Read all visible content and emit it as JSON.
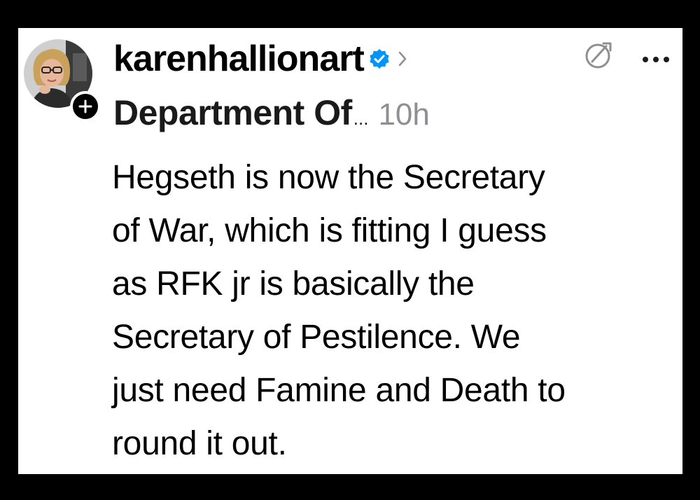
{
  "post": {
    "author": {
      "username": "karenhallionart",
      "verified": true,
      "avatar_icon": "profile-photo"
    },
    "topic": "Department Of",
    "topic_ellipsis": "...",
    "timestamp": "10h",
    "text_lines": [
      "Hegseth is now the Secretary",
      "of War, which is fitting I guess",
      "as RFK jr is basically the",
      "Secretary of Pestilence. We",
      "just need Famine and Death to",
      "round it out."
    ]
  },
  "icons": {
    "verified": "verified-badge-icon",
    "chevron": "chevron-right-icon",
    "follow": "plus-icon",
    "translate": "translate-icon",
    "more": "more-horizontal-icon"
  },
  "colors": {
    "background": "#000000",
    "card": "#ffffff",
    "text": "#000000",
    "timestamp": "#8e8e93",
    "verified_badge": "#0095f6"
  }
}
